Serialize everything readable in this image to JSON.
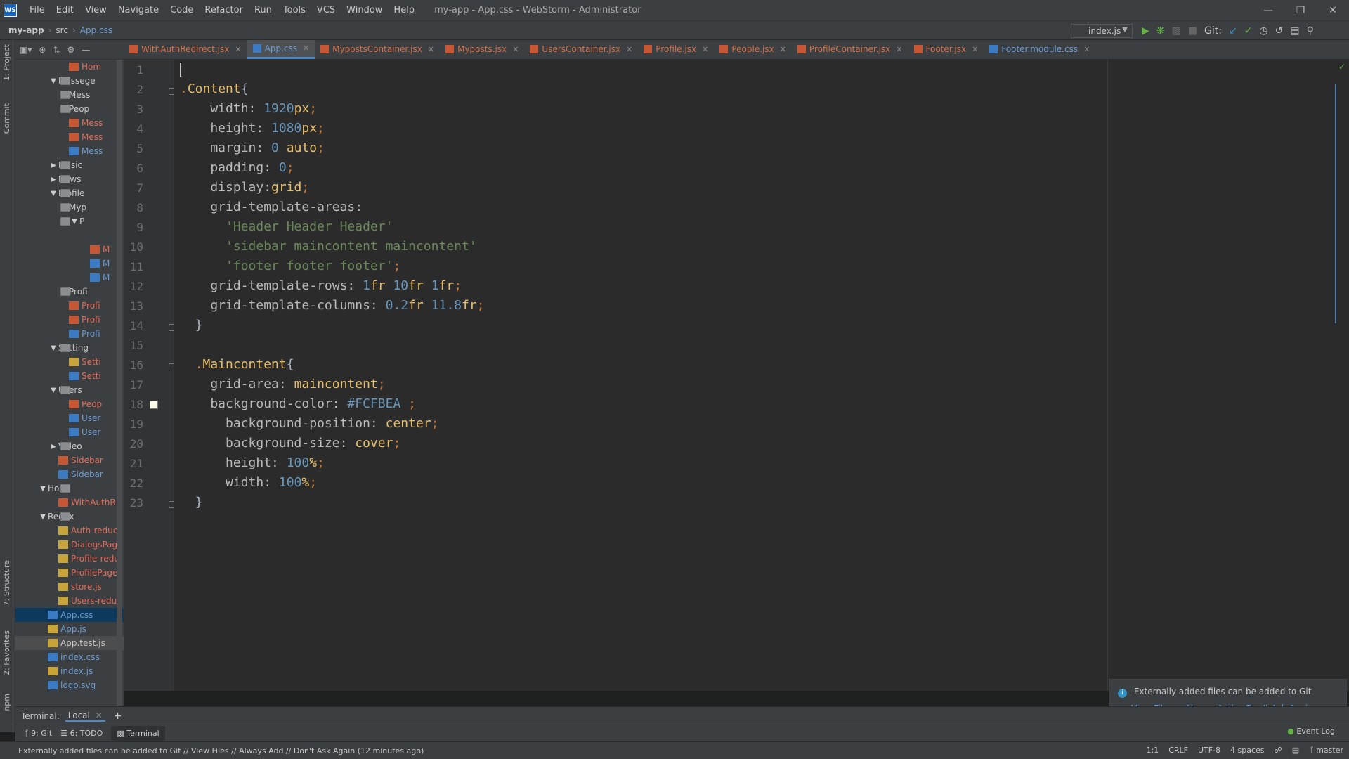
{
  "window": {
    "title": "my-app - App.css - WebStorm - Administrator",
    "logo": "WS",
    "menu": [
      "File",
      "Edit",
      "View",
      "Navigate",
      "Code",
      "Refactor",
      "Run",
      "Tools",
      "VCS",
      "Window",
      "Help"
    ]
  },
  "breadcrumb": {
    "project": "my-app",
    "folder": "src",
    "file": "App.css"
  },
  "toolbar": {
    "run_config": "index.js",
    "git_label": "Git:"
  },
  "left_strip": {
    "project": "1: Project",
    "commit": "Commit",
    "structure": "7: Structure",
    "favorites": "2: Favorites",
    "npm": "npm"
  },
  "tree": [
    {
      "label": "Hom",
      "type": "jsx",
      "depth": 4,
      "red": true
    },
    {
      "label": "Messege",
      "type": "folder",
      "depth": 3,
      "open": true
    },
    {
      "label": "Mess",
      "type": "folder",
      "depth": 4,
      "open": false
    },
    {
      "label": "Peop",
      "type": "folder",
      "depth": 4,
      "open": false
    },
    {
      "label": "Mess",
      "type": "jsx",
      "depth": 4,
      "red": true
    },
    {
      "label": "Mess",
      "type": "jsx",
      "depth": 4,
      "red": true
    },
    {
      "label": "Mess",
      "type": "css",
      "depth": 4,
      "blue": true
    },
    {
      "label": "Music",
      "type": "folder",
      "depth": 3,
      "open": false
    },
    {
      "label": "News",
      "type": "folder",
      "depth": 3,
      "open": false
    },
    {
      "label": "Profile",
      "type": "folder",
      "depth": 3,
      "open": true
    },
    {
      "label": "Myp",
      "type": "folder",
      "depth": 4,
      "open": true
    },
    {
      "label": "P",
      "type": "folder",
      "depth": 5,
      "open": true
    },
    {
      "label": "",
      "type": "none",
      "depth": 6
    },
    {
      "label": "M",
      "type": "jsx",
      "depth": 6,
      "red": true
    },
    {
      "label": "M",
      "type": "css",
      "depth": 6,
      "blue": true
    },
    {
      "label": "M",
      "type": "css",
      "depth": 6,
      "blue": true
    },
    {
      "label": "Profi",
      "type": "folder",
      "depth": 4,
      "open": false
    },
    {
      "label": "Profi",
      "type": "jsx",
      "depth": 4,
      "red": true
    },
    {
      "label": "Profi",
      "type": "jsx",
      "depth": 4,
      "red": true
    },
    {
      "label": "Profi",
      "type": "css",
      "depth": 4,
      "blue": true
    },
    {
      "label": "Setting",
      "type": "folder",
      "depth": 3,
      "open": true
    },
    {
      "label": "Setti",
      "type": "js",
      "depth": 4,
      "red": true
    },
    {
      "label": "Setti",
      "type": "css",
      "depth": 4,
      "red": true
    },
    {
      "label": "Users",
      "type": "folder",
      "depth": 3,
      "open": true
    },
    {
      "label": "Peop",
      "type": "jsx",
      "depth": 4,
      "red": true
    },
    {
      "label": "User",
      "type": "css",
      "depth": 4,
      "blue": true
    },
    {
      "label": "User",
      "type": "css",
      "depth": 4,
      "blue": true
    },
    {
      "label": "Video",
      "type": "folder",
      "depth": 3,
      "open": false
    },
    {
      "label": "Sidebar",
      "type": "jsx",
      "depth": 3,
      "red": true
    },
    {
      "label": "Sidebar",
      "type": "css",
      "depth": 3,
      "blue": true
    },
    {
      "label": "Hoc",
      "type": "folder",
      "depth": 2,
      "open": true
    },
    {
      "label": "WithAuthR",
      "type": "jsx",
      "depth": 3,
      "red": true
    },
    {
      "label": "Redux",
      "type": "folder",
      "depth": 2,
      "open": true
    },
    {
      "label": "Auth-reduc",
      "type": "js",
      "depth": 3,
      "red": true
    },
    {
      "label": "DialogsPag",
      "type": "js",
      "depth": 3,
      "red": true
    },
    {
      "label": "Profile-redu",
      "type": "js",
      "depth": 3,
      "red": true
    },
    {
      "label": "ProfilePage",
      "type": "js",
      "depth": 3,
      "red": true
    },
    {
      "label": "store.js",
      "type": "js",
      "depth": 3,
      "red": true
    },
    {
      "label": "Users-reduc",
      "type": "js",
      "depth": 3,
      "red": true
    },
    {
      "label": "App.css",
      "type": "css",
      "depth": 2,
      "blue": true,
      "selected": true
    },
    {
      "label": "App.js",
      "type": "js",
      "depth": 2,
      "blue": true
    },
    {
      "label": "App.test.js",
      "type": "js",
      "depth": 2,
      "selected2": true
    },
    {
      "label": "index.css",
      "type": "css",
      "depth": 2,
      "blue": true
    },
    {
      "label": "index.js",
      "type": "js",
      "depth": 2,
      "blue": true
    },
    {
      "label": "logo.svg",
      "type": "css",
      "depth": 2,
      "blue": true
    }
  ],
  "tabs": [
    {
      "label": "WithAuthRedirect.jsx",
      "css": false,
      "active": false
    },
    {
      "label": "App.css",
      "css": true,
      "active": true
    },
    {
      "label": "MypostsContainer.jsx",
      "css": false,
      "active": false
    },
    {
      "label": "Myposts.jsx",
      "css": false,
      "active": false
    },
    {
      "label": "UsersContainer.jsx",
      "css": false,
      "active": false
    },
    {
      "label": "Profile.jsx",
      "css": false,
      "active": false
    },
    {
      "label": "People.jsx",
      "css": false,
      "active": false
    },
    {
      "label": "ProfileContainer.jsx",
      "css": false,
      "active": false
    },
    {
      "label": "Footer.jsx",
      "css": false,
      "active": false
    },
    {
      "label": "Footer.module.css",
      "css": true,
      "active": false
    }
  ],
  "code_lines": [
    [],
    [
      [
        "pun",
        "."
      ],
      [
        "sel-",
        "Content"
      ],
      [
        "bracket",
        "{"
      ]
    ],
    [
      [
        "prop",
        "    width: "
      ],
      [
        "num",
        "1920"
      ],
      [
        "val",
        "px"
      ],
      [
        "pun",
        ";"
      ]
    ],
    [
      [
        "prop",
        "    height: "
      ],
      [
        "num",
        "1080"
      ],
      [
        "val",
        "px"
      ],
      [
        "pun",
        ";"
      ]
    ],
    [
      [
        "prop",
        "    margin: "
      ],
      [
        "num",
        "0"
      ],
      [
        "val",
        " auto"
      ],
      [
        "pun",
        ";"
      ]
    ],
    [
      [
        "prop",
        "    padding: "
      ],
      [
        "num",
        "0"
      ],
      [
        "pun",
        ";"
      ]
    ],
    [
      [
        "prop",
        "    display:"
      ],
      [
        "val",
        "grid"
      ],
      [
        "pun",
        ";"
      ]
    ],
    [
      [
        "prop",
        "    grid-template-areas:"
      ]
    ],
    [
      [
        "str",
        "      'Header Header Header'"
      ]
    ],
    [
      [
        "str",
        "      'sidebar maincontent maincontent'"
      ]
    ],
    [
      [
        "str",
        "      'footer footer footer'"
      ],
      [
        "pun",
        ";"
      ]
    ],
    [
      [
        "prop",
        "    grid-template-rows: "
      ],
      [
        "num",
        "1"
      ],
      [
        "val",
        "fr "
      ],
      [
        "num",
        "10"
      ],
      [
        "val",
        "fr "
      ],
      [
        "num",
        "1"
      ],
      [
        "val",
        "fr"
      ],
      [
        "pun",
        ";"
      ]
    ],
    [
      [
        "prop",
        "    grid-template-columns: "
      ],
      [
        "num",
        "0.2"
      ],
      [
        "val",
        "fr "
      ],
      [
        "num",
        "11.8"
      ],
      [
        "val",
        "fr"
      ],
      [
        "pun",
        ";"
      ]
    ],
    [
      [
        "bracket",
        "  }"
      ]
    ],
    [],
    [
      [
        "pun",
        "  ."
      ],
      [
        "sel-",
        "Maincontent"
      ],
      [
        "bracket",
        "{"
      ]
    ],
    [
      [
        "prop",
        "    grid-area: "
      ],
      [
        "val",
        "maincontent"
      ],
      [
        "pun",
        ";"
      ]
    ],
    [
      [
        "prop",
        "    background-color: "
      ],
      [
        "hash",
        "#FCFBEA"
      ],
      [
        "pun",
        " ;"
      ]
    ],
    [
      [
        "prop",
        "      background-position: "
      ],
      [
        "val",
        "center"
      ],
      [
        "pun",
        ";"
      ]
    ],
    [
      [
        "prop",
        "      background-size: "
      ],
      [
        "val",
        "cover"
      ],
      [
        "pun",
        ";"
      ]
    ],
    [
      [
        "prop",
        "      height: "
      ],
      [
        "num",
        "100"
      ],
      [
        "val",
        "%"
      ],
      [
        "pun",
        ";"
      ]
    ],
    [
      [
        "prop",
        "      width: "
      ],
      [
        "num",
        "100"
      ],
      [
        "val",
        "%"
      ],
      [
        "pun",
        ";"
      ]
    ],
    [
      [
        "bracket",
        "  }"
      ]
    ]
  ],
  "notification": {
    "message": "Externally added files can be added to Git",
    "links": [
      "View Files",
      "Always Add",
      "Don't Ask Again"
    ]
  },
  "terminal": {
    "label": "Terminal:",
    "tab": "Local"
  },
  "bottom_tools": {
    "git": "9: Git",
    "todo": "6: TODO",
    "terminal": "Terminal",
    "event_log": "Event Log"
  },
  "statusbar": {
    "message": "Externally added files can be added to Git // View Files // Always Add // Don't Ask Again (12 minutes ago)",
    "position": "1:1",
    "line_sep": "CRLF",
    "encoding": "UTF-8",
    "indent": "4 spaces",
    "branch": "master"
  },
  "colors": {
    "accent": "#4a88c7",
    "swatch": "#FCFBEA"
  }
}
